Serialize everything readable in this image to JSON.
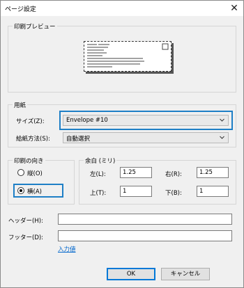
{
  "window": {
    "title": "ページ設定",
    "close_glyph": "✕"
  },
  "preview_group": {
    "label": "印刷プレビュー"
  },
  "paper_group": {
    "label": "用紙",
    "size_label": "サイズ(Z):",
    "size_value": "Envelope #10",
    "source_label": "給紙方法(S):",
    "source_value": "自動選択"
  },
  "orientation_group": {
    "label": "印刷の向き",
    "portrait_label": "縦(O)",
    "landscape_label": "横(A)",
    "selected": "landscape"
  },
  "margins_group": {
    "label": "余白 (ミリ)",
    "left_label": "左(L):",
    "left_value": "1.25",
    "right_label": "右(R):",
    "right_value": "1.25",
    "top_label": "上(T):",
    "top_value": "1",
    "bottom_label": "下(B):",
    "bottom_value": "1"
  },
  "header": {
    "label": "ヘッダー(H):",
    "value": ""
  },
  "footer": {
    "label": "フッター(D):",
    "value": ""
  },
  "input_values_link": "入力値",
  "buttons": {
    "ok": "OK",
    "cancel": "キャンセル"
  },
  "colors": {
    "highlight": "#1e7fc6",
    "link": "#0066cc",
    "default_button_border": "#0078d7"
  },
  "icons": {
    "close": "close-icon",
    "dropdown": "chevron-down-icon"
  }
}
